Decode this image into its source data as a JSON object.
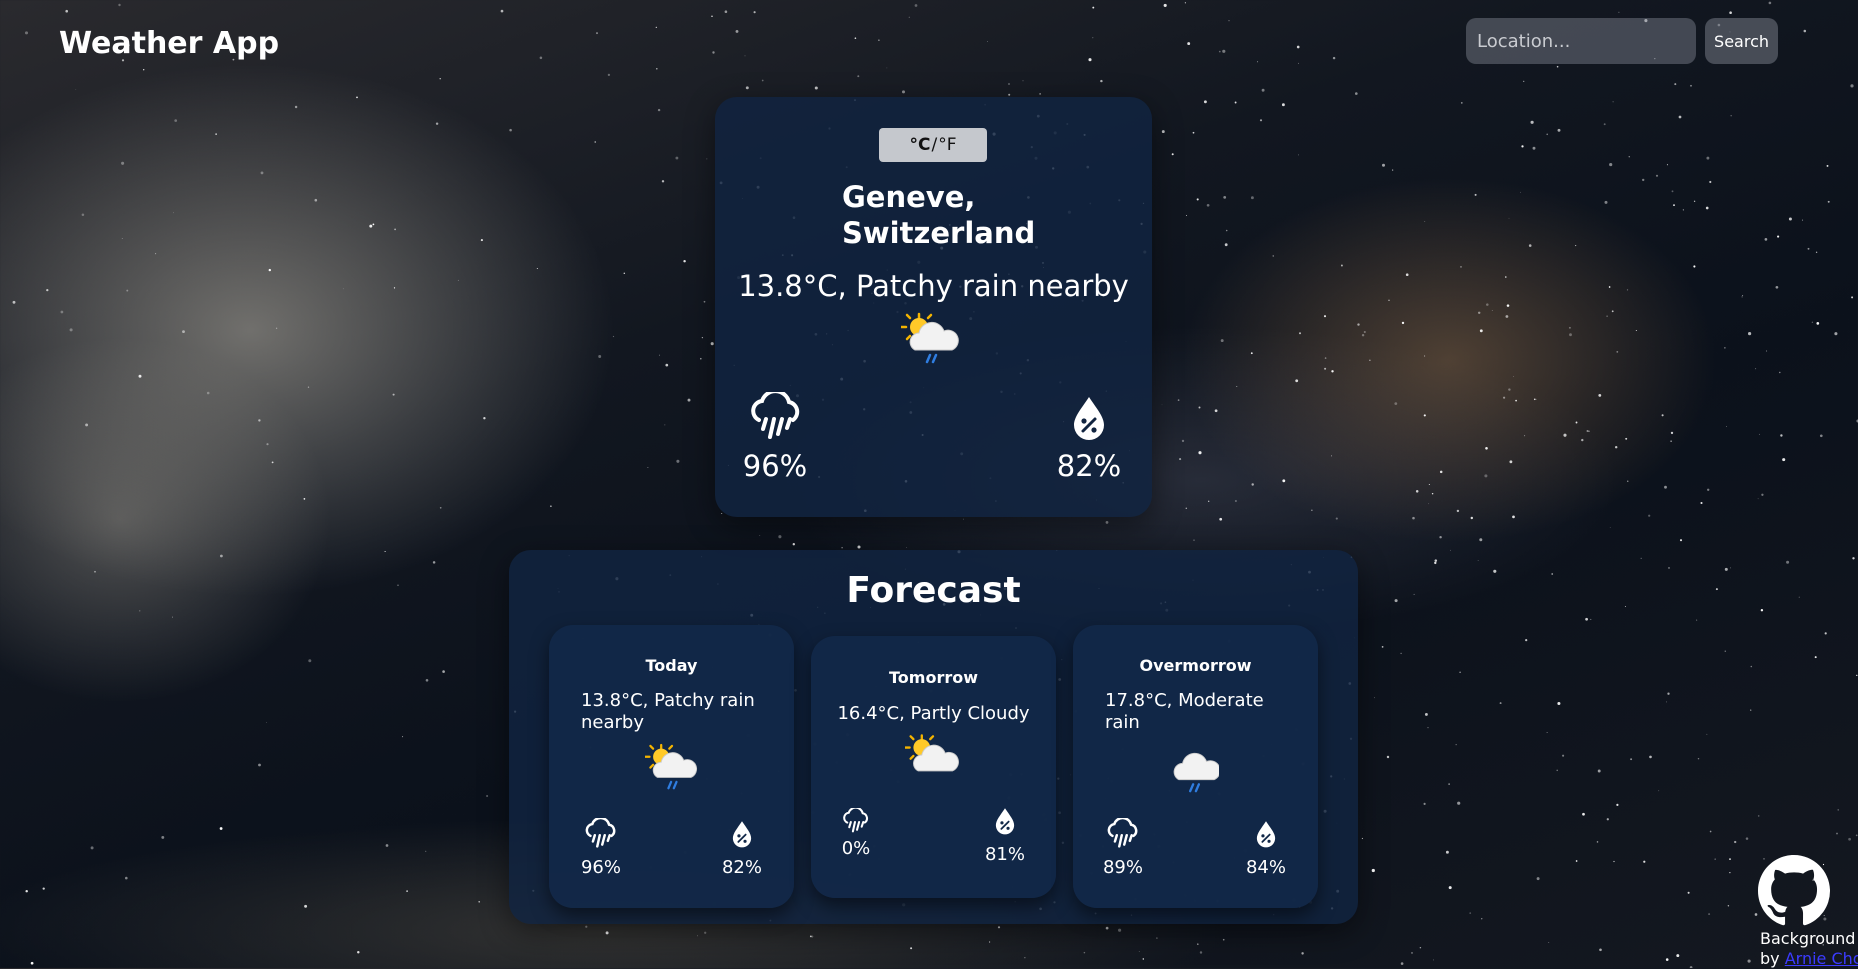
{
  "header": {
    "title": "Weather App"
  },
  "search": {
    "placeholder": "Location...",
    "button_label": "Search"
  },
  "current": {
    "unit_celsius": "°C",
    "unit_separator": "/",
    "unit_fahrenheit": "°F",
    "location": "Geneve, Switzerland",
    "summary": "13.8°C, Patchy rain nearby",
    "condition_icon": "sun-cloud-rain-icon",
    "chance_of_rain": "96%",
    "humidity": "82%"
  },
  "forecast": {
    "title": "Forecast",
    "days": [
      {
        "name": "Today",
        "summary": "13.8°C, Patchy rain nearby",
        "icon": "sun-cloud-rain-icon",
        "chance_of_rain": "96%",
        "humidity": "82%"
      },
      {
        "name": "Tomorrow",
        "summary": "16.4°C, Partly Cloudy",
        "icon": "sun-cloud-icon",
        "chance_of_rain": "0%",
        "humidity": "81%"
      },
      {
        "name": "Overmorrow",
        "summary": "17.8°C, Moderate rain",
        "icon": "cloud-rain-icon",
        "chance_of_rain": "89%",
        "humidity": "84%"
      }
    ]
  },
  "footer": {
    "credit_line1": "Background",
    "credit_prefix": "by",
    "credit_link": "Arnie Chou"
  }
}
